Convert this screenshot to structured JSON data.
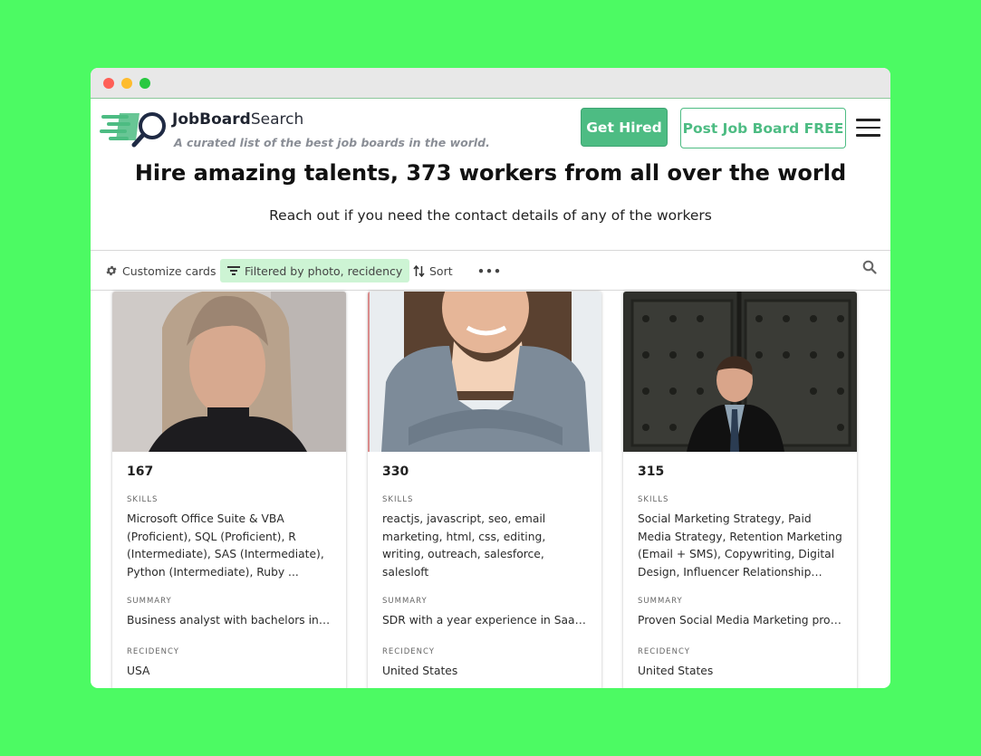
{
  "header": {
    "brand_bold": "JobBoard",
    "brand_light": "Search",
    "tagline": "A curated list of the best job boards in the world.",
    "get_hired_label": "Get Hired",
    "post_label": "Post Job Board FREE"
  },
  "hero": {
    "title": "Hire amazing talents, 373 workers from all over the world",
    "subtitle": "Reach out if you need the contact details of any of the workers"
  },
  "toolbar": {
    "customize_label": "Customize cards",
    "filter_label": "Filtered by photo, recidency",
    "sort_label": "Sort",
    "more_label": "•••"
  },
  "labels": {
    "skills": "SKILLS",
    "summary": "SUMMARY",
    "recidency": "RECIDENCY"
  },
  "cards": [
    {
      "id": "167",
      "skills": "Microsoft Office Suite & VBA (Proficient), SQL (Proficient), R (Intermediate), SAS (Intermediate), Python (Intermediate), Ruby ...",
      "summary": "Business analyst with bachelors in psy...",
      "recidency": "USA"
    },
    {
      "id": "330",
      "skills": "reactjs, javascript, seo, email marketing, html, css, editing, writing, outreach, salesforce, salesloft",
      "summary": "SDR with a year experience in SaaS sa...",
      "recidency": "United States"
    },
    {
      "id": "315",
      "skills": "Social Marketing Strategy, Paid Media Strategy, Retention Marketing (Email + SMS), Copywriting, Digital Design, Influencer Relationship Management,...",
      "summary": "Proven Social Media Marketing profe...",
      "recidency": "United States"
    }
  ],
  "colors": {
    "accent": "#4dbc83",
    "filter_bg": "#cdf4d4",
    "page_bg": "#4cfa63"
  }
}
